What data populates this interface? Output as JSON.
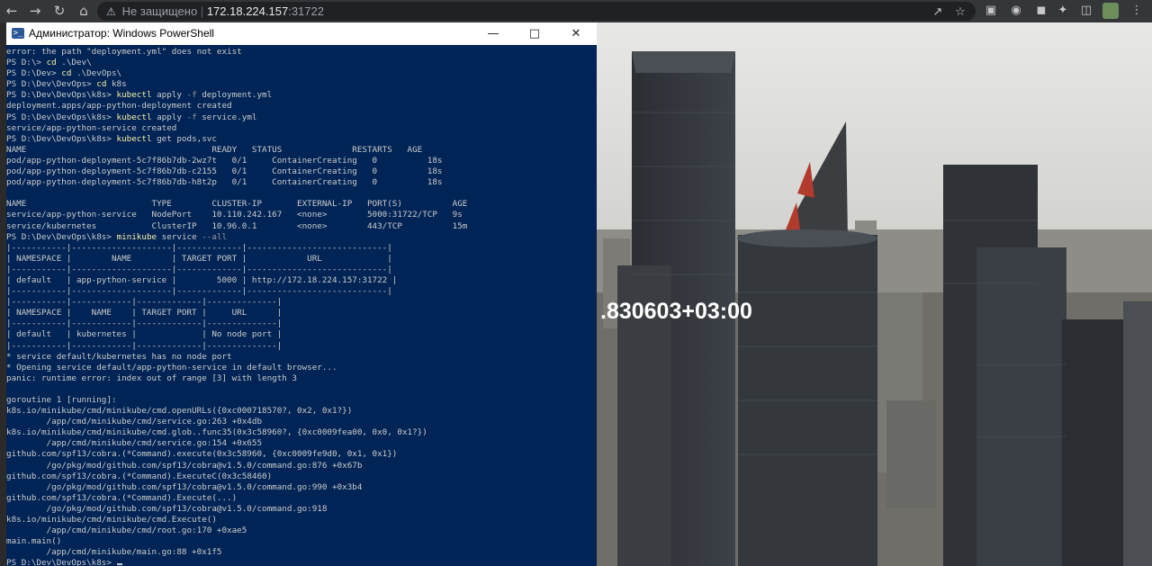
{
  "browser": {
    "security_label": "Не защищено",
    "url_host": "172.18.224.157",
    "url_port": ":31722",
    "icons": [
      "back-icon",
      "forward-icon",
      "reload-icon",
      "home-icon",
      "security-warning-icon",
      "share-icon",
      "bookmark-star-icon",
      "extension-icon",
      "extension-icon",
      "extension-icon",
      "extensions-puzzle-icon",
      "side-panel-icon",
      "profile-avatar-icon",
      "menu-icon"
    ]
  },
  "page": {
    "timestamp_text": ".830603+03:00"
  },
  "terminal": {
    "title": "Администратор: Windows PowerShell",
    "lines": [
      [
        {
          "t": "error: the path \"deployment.yml\" does not exist",
          "c": "ar"
        }
      ],
      [
        {
          "t": "PS D:\\> ",
          "c": "pr"
        },
        {
          "t": "cd",
          "c": "cm"
        },
        {
          "t": " .\\Dev\\",
          "c": "ar"
        }
      ],
      [
        {
          "t": "PS D:\\Dev> ",
          "c": "pr"
        },
        {
          "t": "cd",
          "c": "cm"
        },
        {
          "t": " .\\DevOps\\",
          "c": "ar"
        }
      ],
      [
        {
          "t": "PS D:\\Dev\\DevOps> ",
          "c": "pr"
        },
        {
          "t": "cd",
          "c": "cm"
        },
        {
          "t": " k8s",
          "c": "ar"
        }
      ],
      [
        {
          "t": "PS D:\\Dev\\DevOps\\k8s> ",
          "c": "pr"
        },
        {
          "t": "kubectl",
          "c": "cm"
        },
        {
          "t": " apply ",
          "c": "ar"
        },
        {
          "t": "-f",
          "c": "fl"
        },
        {
          "t": " deployment.yml",
          "c": "ar"
        }
      ],
      [
        {
          "t": "deployment.apps/app-python-deployment created",
          "c": "ar"
        }
      ],
      [
        {
          "t": "PS D:\\Dev\\DevOps\\k8s> ",
          "c": "pr"
        },
        {
          "t": "kubectl",
          "c": "cm"
        },
        {
          "t": " apply ",
          "c": "ar"
        },
        {
          "t": "-f",
          "c": "fl"
        },
        {
          "t": " service.yml",
          "c": "ar"
        }
      ],
      [
        {
          "t": "service/app-python-service created",
          "c": "ar"
        }
      ],
      [
        {
          "t": "PS D:\\Dev\\DevOps\\k8s> ",
          "c": "pr"
        },
        {
          "t": "kubectl",
          "c": "cm"
        },
        {
          "t": " get pods,svc",
          "c": "ar"
        }
      ],
      [
        {
          "t": "NAME                                     READY   STATUS              RESTARTS   AGE",
          "c": "ar"
        }
      ],
      [
        {
          "t": "pod/app-python-deployment-5c7f86b7db-2wz7t   0/1     ContainerCreating   0          18s",
          "c": "ar"
        }
      ],
      [
        {
          "t": "pod/app-python-deployment-5c7f86b7db-c2155   0/1     ContainerCreating   0          18s",
          "c": "ar"
        }
      ],
      [
        {
          "t": "pod/app-python-deployment-5c7f86b7db-h8t2p   0/1     ContainerCreating   0          18s",
          "c": "ar"
        }
      ],
      [
        {
          "t": "",
          "c": "ar"
        }
      ],
      [
        {
          "t": "NAME                         TYPE        CLUSTER-IP       EXTERNAL-IP   PORT(S)          AGE",
          "c": "ar"
        }
      ],
      [
        {
          "t": "service/app-python-service   NodePort    10.110.242.167   <none>        5000:31722/TCP   9s",
          "c": "ar"
        }
      ],
      [
        {
          "t": "service/kubernetes           ClusterIP   10.96.0.1        <none>        443/TCP          15m",
          "c": "ar"
        }
      ],
      [
        {
          "t": "PS D:\\Dev\\DevOps\\k8s> ",
          "c": "pr"
        },
        {
          "t": "minikube",
          "c": "cm"
        },
        {
          "t": " service ",
          "c": "ar"
        },
        {
          "t": "--all",
          "c": "fl"
        }
      ],
      [
        {
          "t": "|-----------|--------------------|-------------|----------------------------|",
          "c": "ar"
        }
      ],
      [
        {
          "t": "| NAMESPACE |        NAME        | TARGET PORT |            URL             |",
          "c": "ar"
        }
      ],
      [
        {
          "t": "|-----------|--------------------|-------------|----------------------------|",
          "c": "ar"
        }
      ],
      [
        {
          "t": "| default   | app-python-service |        5000 | http://172.18.224.157:31722 |",
          "c": "ar"
        }
      ],
      [
        {
          "t": "|-----------|--------------------|-------------|----------------------------|",
          "c": "ar"
        }
      ],
      [
        {
          "t": "|-----------|------------|-------------|--------------|",
          "c": "ar"
        }
      ],
      [
        {
          "t": "| NAMESPACE |    NAME    | TARGET PORT |     URL      |",
          "c": "ar"
        }
      ],
      [
        {
          "t": "|-----------|------------|-------------|--------------|",
          "c": "ar"
        }
      ],
      [
        {
          "t": "| default   | kubernetes |             | No node port |",
          "c": "ar"
        }
      ],
      [
        {
          "t": "|-----------|------------|-------------|--------------|",
          "c": "ar"
        }
      ],
      [
        {
          "t": "* service default/kubernetes has no node port",
          "c": "ar"
        }
      ],
      [
        {
          "t": "* Opening service default/app-python-service in default browser...",
          "c": "ar"
        }
      ],
      [
        {
          "t": "panic: runtime error: index out of range [3] with length 3",
          "c": "ar"
        }
      ],
      [
        {
          "t": "",
          "c": "ar"
        }
      ],
      [
        {
          "t": "goroutine 1 [running]:",
          "c": "ar"
        }
      ],
      [
        {
          "t": "k8s.io/minikube/cmd/minikube/cmd.openURLs({0xc000718570?, 0x2, 0x1?})",
          "c": "ar"
        }
      ],
      [
        {
          "t": "        /app/cmd/minikube/cmd/service.go:263 +0x4db",
          "c": "ar"
        }
      ],
      [
        {
          "t": "k8s.io/minikube/cmd/minikube/cmd.glob..func35(0x3c58960?, {0xc0009fea00, 0x0, 0x1?})",
          "c": "ar"
        }
      ],
      [
        {
          "t": "        /app/cmd/minikube/cmd/service.go:154 +0x655",
          "c": "ar"
        }
      ],
      [
        {
          "t": "github.com/spf13/cobra.(*Command).execute(0x3c58960, {0xc0009fe9d0, 0x1, 0x1})",
          "c": "ar"
        }
      ],
      [
        {
          "t": "        /go/pkg/mod/github.com/spf13/cobra@v1.5.0/command.go:876 +0x67b",
          "c": "ar"
        }
      ],
      [
        {
          "t": "github.com/spf13/cobra.(*Command).ExecuteC(0x3c58460)",
          "c": "ar"
        }
      ],
      [
        {
          "t": "        /go/pkg/mod/github.com/spf13/cobra@v1.5.0/command.go:990 +0x3b4",
          "c": "ar"
        }
      ],
      [
        {
          "t": "github.com/spf13/cobra.(*Command).Execute(...)",
          "c": "ar"
        }
      ],
      [
        {
          "t": "        /go/pkg/mod/github.com/spf13/cobra@v1.5.0/command.go:918",
          "c": "ar"
        }
      ],
      [
        {
          "t": "k8s.io/minikube/cmd/minikube/cmd.Execute()",
          "c": "ar"
        }
      ],
      [
        {
          "t": "        /app/cmd/minikube/cmd/root.go:170 +0xae5",
          "c": "ar"
        }
      ],
      [
        {
          "t": "main.main()",
          "c": "ar"
        }
      ],
      [
        {
          "t": "        /app/cmd/minikube/main.go:88 +0x1f5",
          "c": "ar"
        }
      ],
      [
        {
          "t": "PS D:\\Dev\\DevOps\\k8s> ",
          "c": "pr"
        }
      ]
    ]
  },
  "colors": {
    "terminal_bg": "#012456",
    "terminal_text": "#cccccc",
    "command_yellow": "#f9f1a5",
    "browser_chrome": "#35363a"
  }
}
